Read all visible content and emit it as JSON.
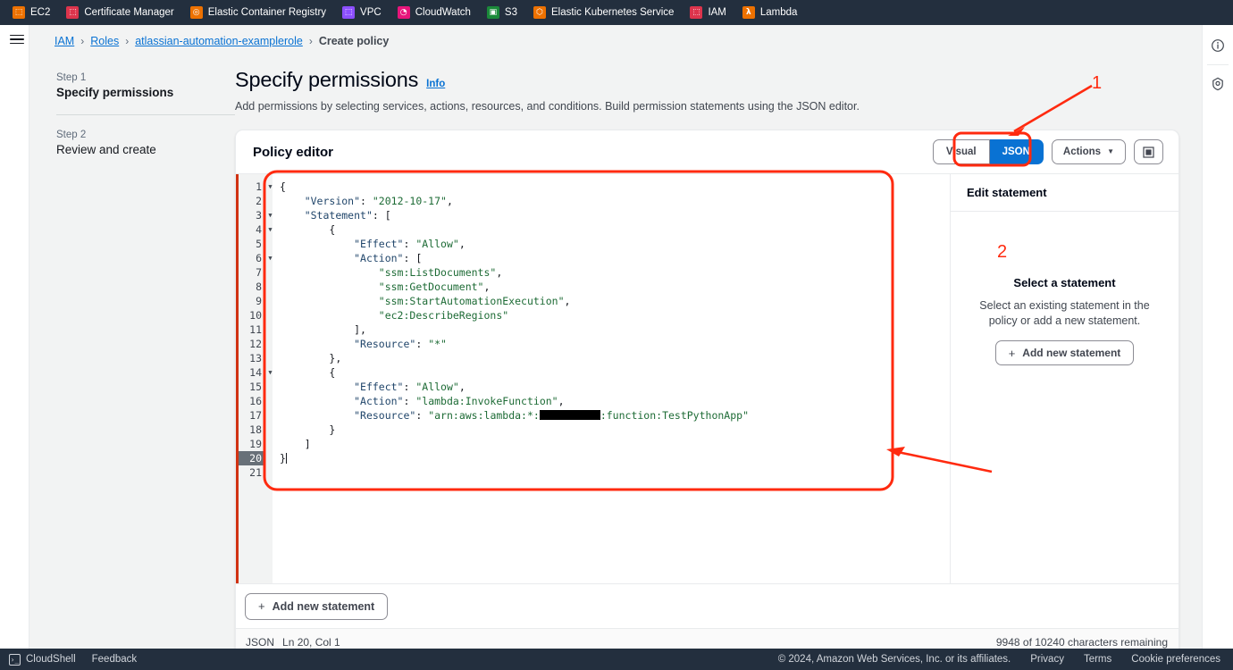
{
  "service_bar": {
    "items": [
      {
        "label": "EC2",
        "icon": "ec2-icon",
        "color": "#ed7100",
        "glyph": "⬚"
      },
      {
        "label": "Certificate Manager",
        "icon": "certificate-manager-icon",
        "color": "#dd344c",
        "glyph": "⬚"
      },
      {
        "label": "Elastic Container Registry",
        "icon": "elastic-container-registry-icon",
        "color": "#ed7100",
        "glyph": "◎"
      },
      {
        "label": "VPC",
        "icon": "vpc-icon",
        "color": "#8c4fff",
        "glyph": "⬚"
      },
      {
        "label": "CloudWatch",
        "icon": "cloudwatch-icon",
        "color": "#e7157b",
        "glyph": "◔"
      },
      {
        "label": "S3",
        "icon": "s3-icon",
        "color": "#1b8a3a",
        "glyph": "▣"
      },
      {
        "label": "Elastic Kubernetes Service",
        "icon": "elastic-kubernetes-service-icon",
        "color": "#ed7100",
        "glyph": "⬡"
      },
      {
        "label": "IAM",
        "icon": "iam-icon",
        "color": "#dd344c",
        "glyph": "⬚"
      },
      {
        "label": "Lambda",
        "icon": "lambda-icon",
        "color": "#ed7100",
        "glyph": "λ"
      }
    ]
  },
  "breadcrumb": {
    "items": [
      {
        "label": "IAM",
        "link": true
      },
      {
        "label": "Roles",
        "link": true
      },
      {
        "label": "atlassian-automation-examplerole",
        "link": true
      },
      {
        "label": "Create policy",
        "link": false
      }
    ],
    "separator": "›"
  },
  "steps": [
    {
      "number": "Step 1",
      "name": "Specify permissions",
      "active": true
    },
    {
      "number": "Step 2",
      "name": "Review and create",
      "active": false
    }
  ],
  "page": {
    "title": "Specify permissions",
    "info_label": "Info",
    "subtitle": "Add permissions by selecting services, actions, resources, and conditions. Build permission statements using the JSON editor."
  },
  "policy_editor": {
    "title": "Policy editor",
    "view_visual": "Visual",
    "view_json": "JSON",
    "selected_view": "JSON",
    "actions_label": "Actions",
    "actions_caret": "▼",
    "fullscreen_icon": "▣",
    "add_statement_footer": "Add new statement",
    "plus": "+"
  },
  "code": {
    "fold_glyph": "▼",
    "cursor_line": 20,
    "lines": [
      {
        "n": 1,
        "fold": true,
        "indent": 0,
        "tokens": [
          {
            "t": "{",
            "c": "p"
          }
        ]
      },
      {
        "n": 2,
        "fold": false,
        "indent": 1,
        "tokens": [
          {
            "t": "\"Version\"",
            "c": "k"
          },
          {
            "t": ": ",
            "c": "p"
          },
          {
            "t": "\"2012-10-17\"",
            "c": "s"
          },
          {
            "t": ",",
            "c": "p"
          }
        ]
      },
      {
        "n": 3,
        "fold": true,
        "indent": 1,
        "tokens": [
          {
            "t": "\"Statement\"",
            "c": "k"
          },
          {
            "t": ": [",
            "c": "p"
          }
        ]
      },
      {
        "n": 4,
        "fold": true,
        "indent": 2,
        "tokens": [
          {
            "t": "{",
            "c": "p"
          }
        ]
      },
      {
        "n": 5,
        "fold": false,
        "indent": 3,
        "tokens": [
          {
            "t": "\"Effect\"",
            "c": "k"
          },
          {
            "t": ": ",
            "c": "p"
          },
          {
            "t": "\"Allow\"",
            "c": "s"
          },
          {
            "t": ",",
            "c": "p"
          }
        ]
      },
      {
        "n": 6,
        "fold": true,
        "indent": 3,
        "tokens": [
          {
            "t": "\"Action\"",
            "c": "k"
          },
          {
            "t": ": [",
            "c": "p"
          }
        ]
      },
      {
        "n": 7,
        "fold": false,
        "indent": 4,
        "tokens": [
          {
            "t": "\"ssm:ListDocuments\"",
            "c": "s"
          },
          {
            "t": ",",
            "c": "p"
          }
        ]
      },
      {
        "n": 8,
        "fold": false,
        "indent": 4,
        "tokens": [
          {
            "t": "\"ssm:GetDocument\"",
            "c": "s"
          },
          {
            "t": ",",
            "c": "p"
          }
        ]
      },
      {
        "n": 9,
        "fold": false,
        "indent": 4,
        "tokens": [
          {
            "t": "\"ssm:StartAutomationExecution\"",
            "c": "s"
          },
          {
            "t": ",",
            "c": "p"
          }
        ]
      },
      {
        "n": 10,
        "fold": false,
        "indent": 4,
        "tokens": [
          {
            "t": "\"ec2:DescribeRegions\"",
            "c": "s"
          }
        ]
      },
      {
        "n": 11,
        "fold": false,
        "indent": 3,
        "tokens": [
          {
            "t": "],",
            "c": "p"
          }
        ]
      },
      {
        "n": 12,
        "fold": false,
        "indent": 3,
        "tokens": [
          {
            "t": "\"Resource\"",
            "c": "k"
          },
          {
            "t": ": ",
            "c": "p"
          },
          {
            "t": "\"*\"",
            "c": "s"
          }
        ]
      },
      {
        "n": 13,
        "fold": false,
        "indent": 2,
        "tokens": [
          {
            "t": "},",
            "c": "p"
          }
        ]
      },
      {
        "n": 14,
        "fold": true,
        "indent": 2,
        "tokens": [
          {
            "t": "{",
            "c": "p"
          }
        ]
      },
      {
        "n": 15,
        "fold": false,
        "indent": 3,
        "tokens": [
          {
            "t": "\"Effect\"",
            "c": "k"
          },
          {
            "t": ": ",
            "c": "p"
          },
          {
            "t": "\"Allow\"",
            "c": "s"
          },
          {
            "t": ",",
            "c": "p"
          }
        ]
      },
      {
        "n": 16,
        "fold": false,
        "indent": 3,
        "tokens": [
          {
            "t": "\"Action\"",
            "c": "k"
          },
          {
            "t": ": ",
            "c": "p"
          },
          {
            "t": "\"lambda:InvokeFunction\"",
            "c": "s"
          },
          {
            "t": ",",
            "c": "p"
          }
        ]
      },
      {
        "n": 17,
        "fold": false,
        "indent": 3,
        "tokens": [
          {
            "t": "\"Resource\"",
            "c": "k"
          },
          {
            "t": ": ",
            "c": "p"
          },
          {
            "t": "\"arn:aws:lambda:*:",
            "c": "s"
          },
          {
            "t": "",
            "c": "redacted"
          },
          {
            "t": ":function:TestPythonApp\"",
            "c": "s"
          }
        ]
      },
      {
        "n": 18,
        "fold": false,
        "indent": 2,
        "tokens": [
          {
            "t": "}",
            "c": "p"
          }
        ]
      },
      {
        "n": 19,
        "fold": false,
        "indent": 1,
        "tokens": [
          {
            "t": "]",
            "c": "p"
          }
        ]
      },
      {
        "n": 20,
        "fold": false,
        "indent": 0,
        "tokens": [
          {
            "t": "}",
            "c": "p"
          },
          {
            "t": "",
            "c": "caret"
          }
        ]
      },
      {
        "n": 21,
        "fold": false,
        "indent": 0,
        "tokens": []
      }
    ]
  },
  "side_panel": {
    "header": "Edit statement",
    "empty_title": "Select a statement",
    "empty_desc": "Select an existing statement in the policy or add a new statement.",
    "add_button": "Add new statement",
    "plus": "+"
  },
  "status_bar": {
    "format": "JSON",
    "cursor": "Ln 20, Col 1",
    "characters": "9948 of 10240 characters remaining"
  },
  "rail_icons": [
    {
      "name": "info-icon",
      "glyph": "ⓘ"
    },
    {
      "name": "settings-shield-icon",
      "glyph": "⬡"
    }
  ],
  "footer": {
    "cloudshell": "CloudShell",
    "cloudshell_glyph": "›_",
    "feedback": "Feedback",
    "copyright": "© 2024, Amazon Web Services, Inc. or its affiliates.",
    "links": [
      "Privacy",
      "Terms",
      "Cookie preferences"
    ]
  },
  "annotations": {
    "accent_color": "#ff2a0f",
    "markers": [
      {
        "label": "1",
        "target": "json-tab-button"
      },
      {
        "label": "2",
        "target": "json-code-editor"
      }
    ]
  }
}
